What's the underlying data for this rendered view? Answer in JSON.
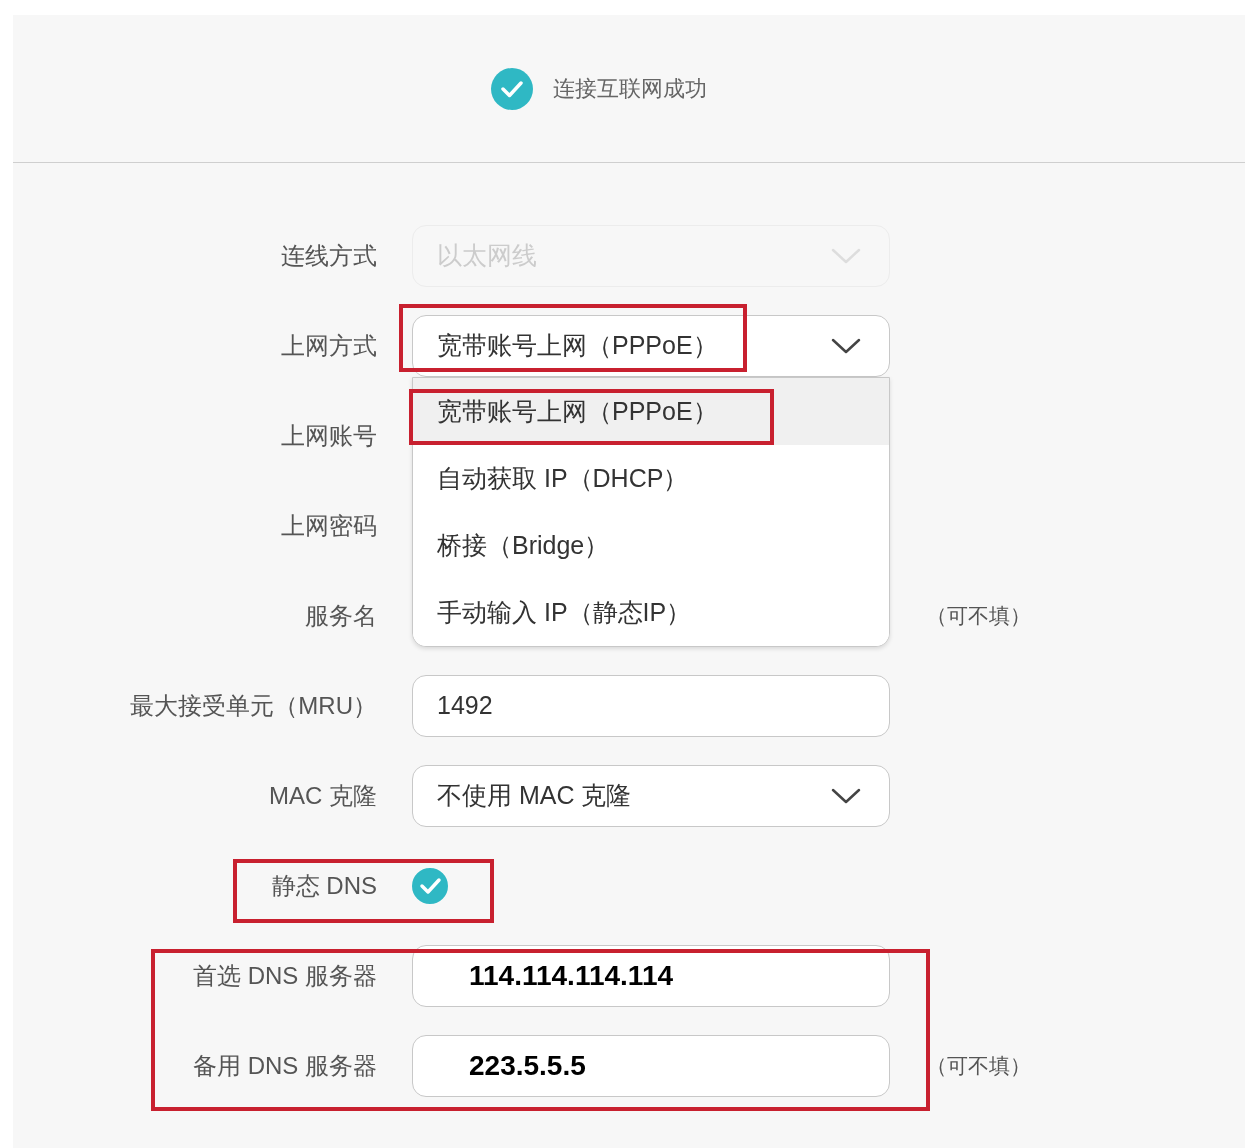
{
  "status": {
    "text": "连接互联网成功"
  },
  "fields": [
    {
      "label": "连线方式",
      "kind": "select",
      "value": "以太网线",
      "disabled": true
    },
    {
      "label": "上网方式",
      "kind": "select",
      "value": "宽带账号上网（PPPoE）",
      "disabled": false,
      "expanded": true,
      "options": [
        {
          "label": "宽带账号上网（PPPoE）",
          "selected": true
        },
        {
          "label": "自动获取 IP（DHCP）",
          "selected": false
        },
        {
          "label": "桥接（Bridge）",
          "selected": false
        },
        {
          "label": "手动输入 IP（静态IP）",
          "selected": false
        }
      ]
    },
    {
      "label": "上网账号",
      "kind": "covered"
    },
    {
      "label": "上网密码",
      "kind": "covered"
    },
    {
      "label": "服务名",
      "kind": "covered",
      "note": "（可不填）"
    },
    {
      "label": "最大接受单元（MRU）",
      "kind": "text",
      "value": "1492",
      "bold": false
    },
    {
      "label": "MAC 克隆",
      "kind": "select",
      "value": "不使用 MAC 克隆",
      "disabled": false
    },
    {
      "label": "静态 DNS",
      "kind": "checkbox",
      "checked": true
    },
    {
      "label": "首选 DNS 服务器",
      "kind": "text",
      "value": "114.114.114.114",
      "bold": true
    },
    {
      "label": "备用 DNS 服务器",
      "kind": "text",
      "value": "223.5.5.5",
      "bold": true,
      "note": "（可不填）"
    }
  ]
}
